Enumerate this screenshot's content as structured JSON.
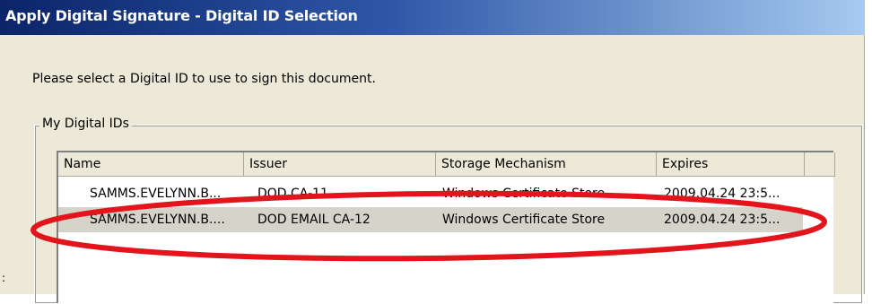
{
  "dialog": {
    "title": "Apply Digital Signature - Digital ID Selection",
    "instruction": "Please select a Digital ID to use to sign this document.",
    "group_label": "My Digital IDs"
  },
  "table": {
    "columns": [
      "Name",
      "Issuer",
      "Storage Mechanism",
      "Expires"
    ],
    "rows": [
      {
        "name": "SAMMS.EVELYNN.B...",
        "issuer": "DOD CA-11",
        "storage": "Windows Certificate Store",
        "expires": "2009.04.24 23:5..."
      },
      {
        "name": "SAMMS.EVELYNN.B....",
        "issuer": "DOD EMAIL CA-12",
        "storage": "Windows Certificate Store",
        "expires": "2009.04.24 23:5..."
      }
    ],
    "selected_row": 1
  },
  "annotation": {
    "stroke_color": "#e3141b",
    "stray_mark": ":"
  }
}
